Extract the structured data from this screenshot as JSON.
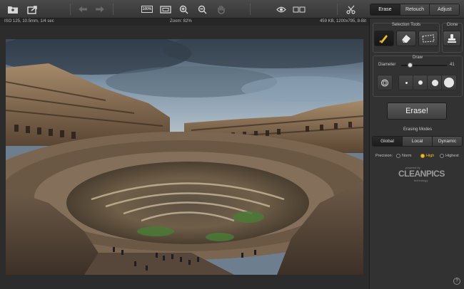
{
  "toolbar": {
    "open_icon": "folder-open-icon",
    "share_icon": "share-icon",
    "undo_icon": "undo-icon",
    "redo_icon": "redo-icon",
    "zoom_100_label": "100%",
    "fit_icon": "fit-to-screen-icon",
    "zoom_in_icon": "zoom-in-icon",
    "zoom_out_icon": "zoom-out-icon",
    "pan_icon": "hand-icon",
    "preview_icon": "eye-icon",
    "compare_icon": "split-view-icon",
    "cut_icon": "scissors-icon"
  },
  "mode_tabs": [
    {
      "label": "Erase",
      "active": true
    },
    {
      "label": "Retouch",
      "active": false
    },
    {
      "label": "Adjust",
      "active": false
    }
  ],
  "infobar": {
    "exif": "ISO 125, 10.5mm, 1/4 sec",
    "zoom": "Zoom: 82%",
    "file_info": "459 KB, 1200x795, 8-Bit"
  },
  "panel": {
    "selection_tools_title": "Selection Tools",
    "clone_title": "Clone",
    "draw_title": "Draw",
    "diameter_label": "Diameter",
    "diameter_value": "41",
    "diameter_fraction": 0.2,
    "erase_button": "Erase!",
    "erasing_modes_title": "Erasing Modes",
    "erasing_modes": [
      {
        "label": "Global",
        "active": true
      },
      {
        "label": "Local",
        "active": false
      },
      {
        "label": "Dynamic",
        "active": false
      }
    ],
    "precision_label": "Precision:",
    "precision_options": [
      {
        "label": "Norm",
        "selected": false
      },
      {
        "label": "High",
        "selected": true
      },
      {
        "label": "Highest",
        "selected": false
      }
    ],
    "logo_powered": "powered by",
    "logo_brand": "CLEANPICS",
    "logo_tech": "technology",
    "help_label": "?"
  },
  "colors": {
    "accent": "#f0c020",
    "panel_bg": "#323232",
    "toolbar_bg": "#3e3e3e"
  }
}
